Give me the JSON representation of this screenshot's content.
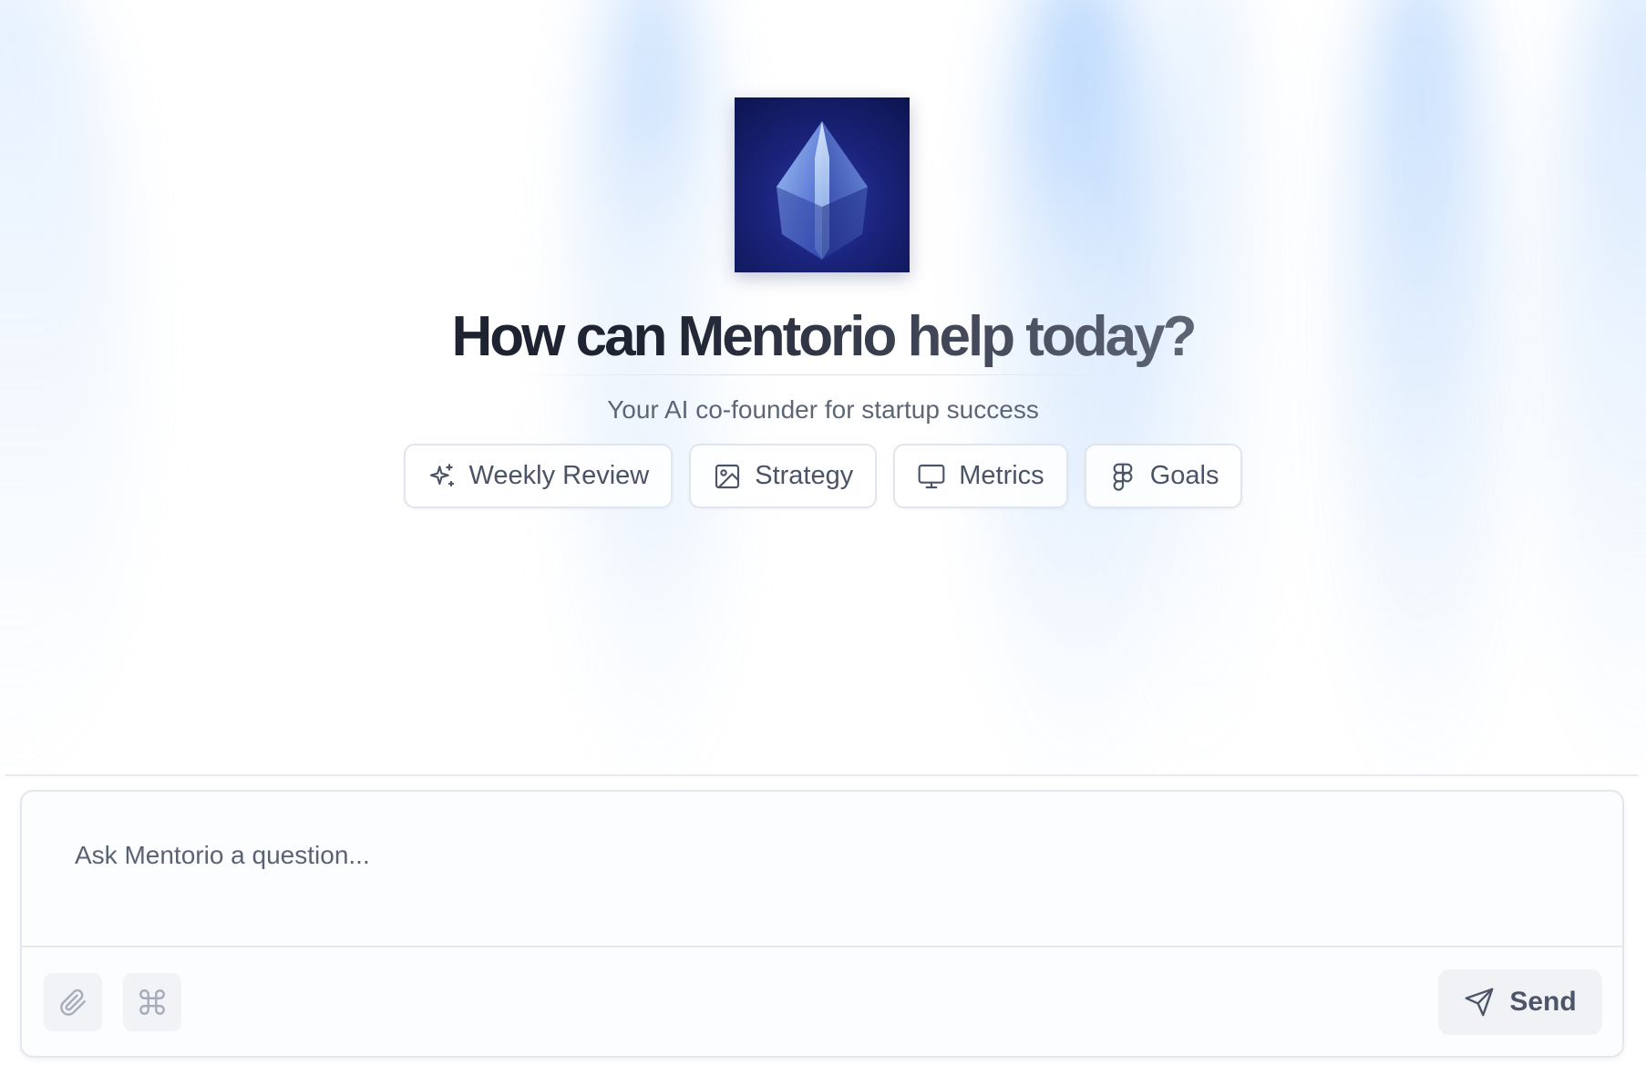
{
  "hero": {
    "title": "How can Mentorio help today?",
    "subtitle": "Your AI co-founder for startup success"
  },
  "quick_actions": [
    {
      "label": "Weekly Review",
      "icon": "sparkles-icon"
    },
    {
      "label": "Strategy",
      "icon": "image-icon"
    },
    {
      "label": "Metrics",
      "icon": "monitor-icon"
    },
    {
      "label": "Goals",
      "icon": "figma-icon"
    }
  ],
  "composer": {
    "placeholder": "Ask Mentorio a question...",
    "attach_icon": "paperclip-icon",
    "command_icon": "command-icon",
    "send_label": "Send",
    "send_icon": "send-icon"
  },
  "colors": {
    "accent_blue": "#a8cefc",
    "text_dark": "#1c2030",
    "text_muted": "#5d6678",
    "logo_bg": "#1a237a"
  }
}
